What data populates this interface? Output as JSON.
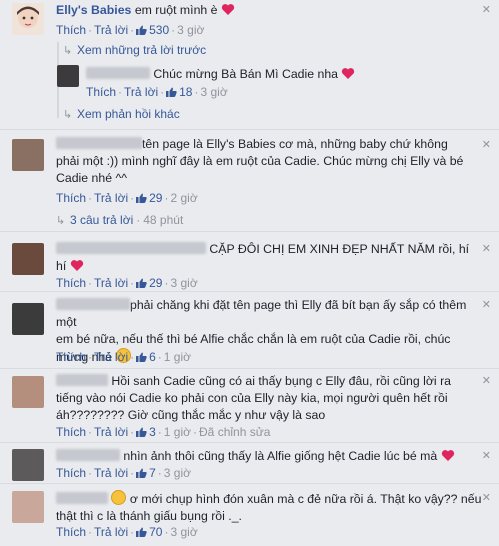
{
  "top": {
    "author": "Elly's Babies",
    "text": "em ruột mình è",
    "like_label": "Thích",
    "reply_label": "Trả lời",
    "likes": "530",
    "time": "3 giờ",
    "prev_replies": "Xem những trả lời trước",
    "reply": {
      "text": "Chúc mừng Bà Bán Mì Cadie nha",
      "likes": "18",
      "time": "3 giờ"
    },
    "more_replies": "Xem phản hồi khác"
  },
  "comments": [
    {
      "line1": "tên page là Elly's Babies cơ mà, những baby chứ không",
      "line2": "phải một :)) mình nghĩ đây là em ruột của Cadie. Chúc mừng chị Elly và bé",
      "line3": "Cadie nhé ^^",
      "likes": "29",
      "time": "2 giờ",
      "replies": "3 câu trả lời",
      "replies_time": "48 phút"
    },
    {
      "line1": "CẶP ĐÔI CHỊ EM XINH ĐẸP NHẤT NĂM rồi, hí",
      "line2": "hí",
      "likes": "29",
      "time": "3 giờ"
    },
    {
      "line1": "phải chăng khi đặt tên page thì Elly đã bít bạn ấy sắp có thêm một",
      "line2": "em bé nữa, nếu thế thì bé Alfie chắc chắn là em ruột của Cadie rồi, chúc",
      "line3": "mừng nhé",
      "likes": "6",
      "time": "1 giờ"
    },
    {
      "line1": "Hồi sanh Cadie cũng có ai thấy bụng c Elly đâu, rồi cũng lời ra",
      "line2": "tiếng vào nói Cadie ko phải con của Elly này kia, mọi người quên hết rồi",
      "line3": "áh???????? Giờ cũng thắc mắc y như vậy là sao",
      "likes": "3",
      "time": "1 giờ",
      "edited": "Đã chỉnh sửa"
    },
    {
      "line1": "nhìn ảnh thôi cũng thấy là Alfie giống hệt Cadie lúc bé mà",
      "likes": "7",
      "time": "3 giờ"
    },
    {
      "line1": "ơ mới chụp hình đón xuân mà c đẻ nữa rồi á. Thật ko vậy?? nếu",
      "line2": "thật thì c là thánh giấu bụng rồi ._.",
      "likes": "70",
      "time": "3 giờ"
    }
  ],
  "colors": {
    "link": "#365899",
    "heart": "#e0245e",
    "background": "#e9ebee"
  },
  "icons": [
    "like-icon",
    "heart-icon",
    "reply-arrow-icon",
    "close-icon",
    "wink-emoji-icon",
    "confused-emoji-icon"
  ]
}
